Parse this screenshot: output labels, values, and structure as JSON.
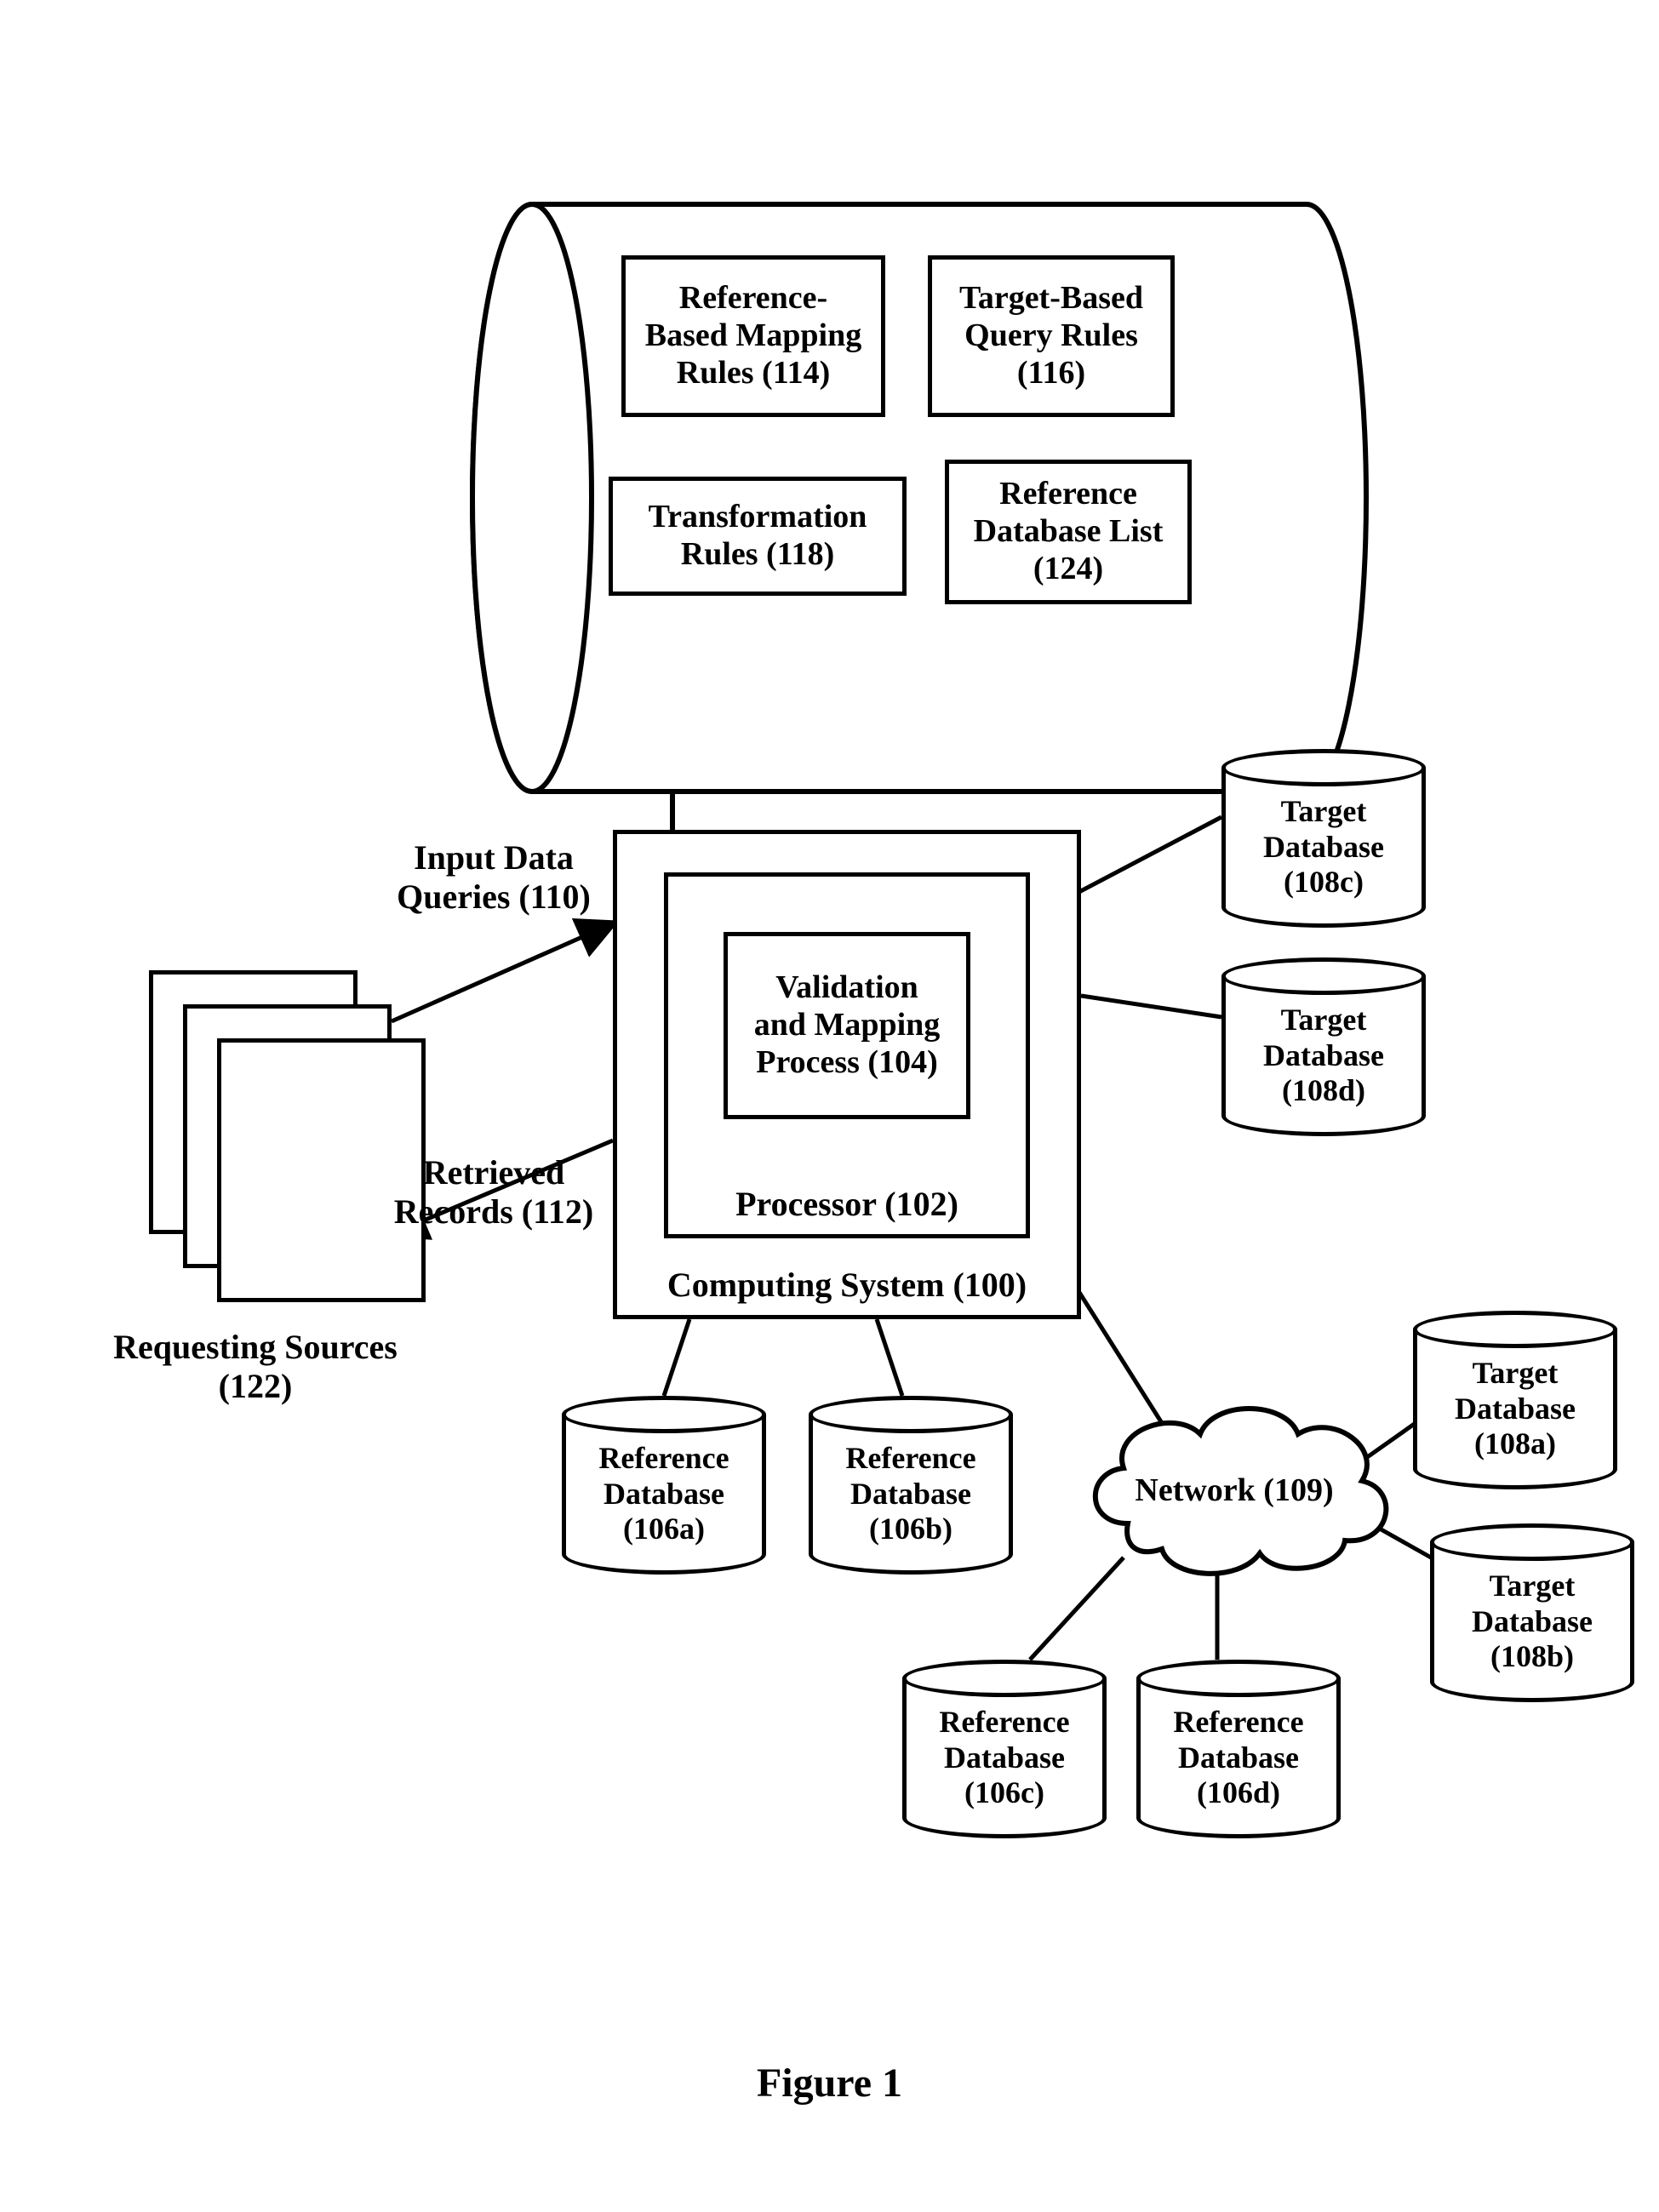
{
  "figure_label": "Figure 1",
  "rules_cyl": {
    "ref_mapping": {
      "l1": "Reference-",
      "l2": "Based Mapping",
      "l3": "Rules (114)"
    },
    "target_query": {
      "l1": "Target-Based",
      "l2": "Query Rules",
      "l3": "(116)"
    },
    "transformation": {
      "l1": "Transformation",
      "l2": "Rules  (118)"
    },
    "ref_db_list": {
      "l1": "Reference",
      "l2": "Database List",
      "l3": "(124)"
    }
  },
  "cs": {
    "l1": "Computing System (100)"
  },
  "proc": {
    "l1": "Processor (102)"
  },
  "vmp": {
    "l1": "Validation",
    "l2": "and Mapping",
    "l3": "Process (104)"
  },
  "req_src": {
    "l1": "Requesting Sources",
    "l2": "(122)"
  },
  "idq": {
    "l1": "Input Data",
    "l2": "Queries (110)"
  },
  "retr": {
    "l1": "Retrieved",
    "l2": "Records (112)"
  },
  "net": {
    "l1": "Network (109)"
  },
  "dbs": {
    "t108c": {
      "l1": "Target",
      "l2": "Database",
      "l3": "(108c)"
    },
    "t108d": {
      "l1": "Target",
      "l2": "Database",
      "l3": "(108d)"
    },
    "t108a": {
      "l1": "Target",
      "l2": "Database",
      "l3": "(108a)"
    },
    "t108b": {
      "l1": "Target",
      "l2": "Database",
      "l3": "(108b)"
    },
    "r106a": {
      "l1": "Reference",
      "l2": "Database",
      "l3": "(106a)"
    },
    "r106b": {
      "l1": "Reference",
      "l2": "Database",
      "l3": "(106b)"
    },
    "r106c": {
      "l1": "Reference",
      "l2": "Database",
      "l3": "(106c)"
    },
    "r106d": {
      "l1": "Reference",
      "l2": "Database",
      "l3": "(106d)"
    }
  }
}
